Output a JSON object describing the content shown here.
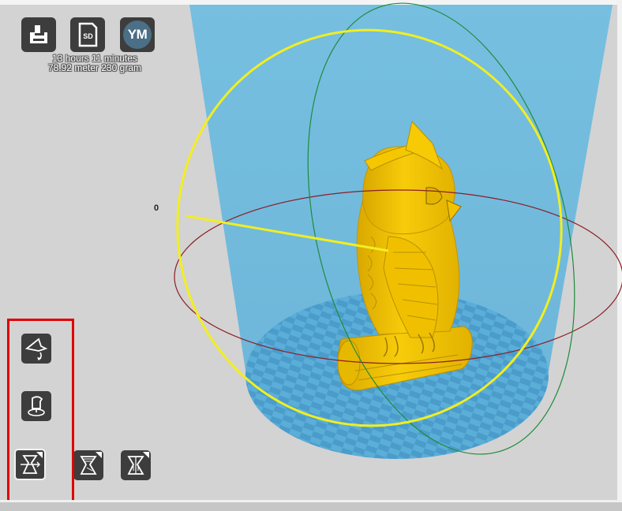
{
  "toolbar": {
    "load_icon": "load-file-icon",
    "sd_label": "SD",
    "account_label": "YM"
  },
  "print_info": {
    "time": "13 hours 11 minutes",
    "material": "78.92 meter 230 gram"
  },
  "rotation": {
    "angle_label": "0"
  },
  "tools": {
    "rotate_icon": "rotate-icon",
    "scale_icon": "scale-icon",
    "mirror_icon": "mirror-icon",
    "mirror_variant_1_icon": "mirror-variant-icon",
    "mirror_variant_2_icon": "mirror-variant-icon"
  },
  "colors": {
    "model": "#f5c400",
    "build_volume": "#72bcdc",
    "ring_yellow": "#f2ee20",
    "ring_green": "#1e8b3a",
    "ring_red": "#8b1f28",
    "annotation": "#e00000"
  }
}
